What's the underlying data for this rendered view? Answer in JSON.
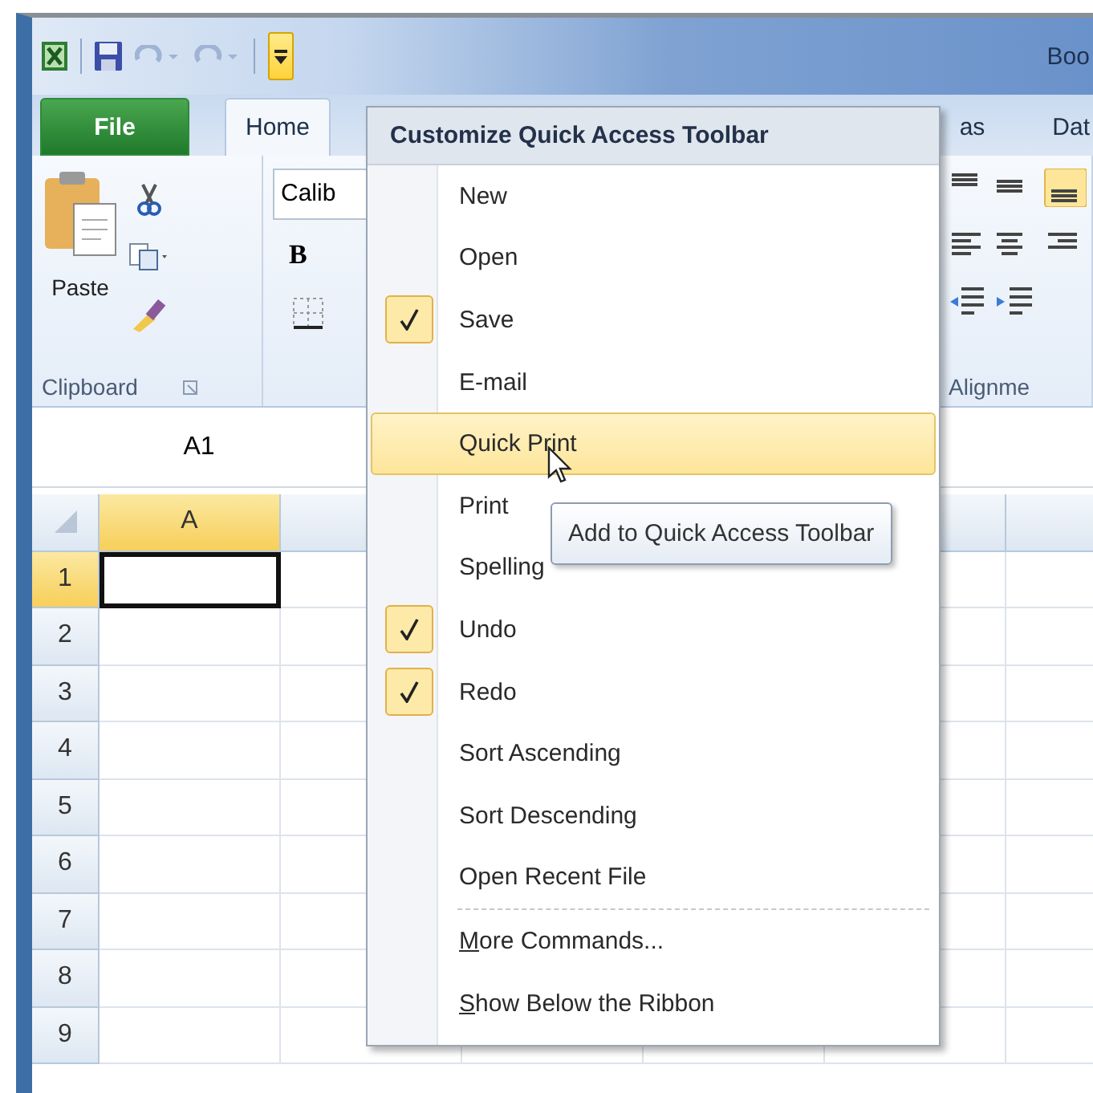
{
  "title_bar": {
    "title": "Boo",
    "customize_open": true
  },
  "tabs": [
    {
      "label": "File",
      "kind": "file",
      "selected": false
    },
    {
      "label": "Home",
      "kind": "tab",
      "selected": true
    },
    {
      "label": "as",
      "kind": "tab",
      "selected": false
    },
    {
      "label": "Dat",
      "kind": "tab",
      "selected": false
    }
  ],
  "ribbon": {
    "clipboard": {
      "paste_label": "Paste",
      "group_label": "Clipboard"
    },
    "font": {
      "font_name": "Calib",
      "bold_label": "B"
    },
    "alignment": {
      "group_label": "Alignme"
    }
  },
  "name_box": "A1",
  "grid": {
    "columns": [
      {
        "label": "A",
        "selected": true
      }
    ],
    "rows": [
      {
        "label": "1",
        "selected": true
      },
      {
        "label": "2",
        "selected": false
      },
      {
        "label": "3",
        "selected": false
      },
      {
        "label": "4",
        "selected": false
      },
      {
        "label": "5",
        "selected": false
      },
      {
        "label": "6",
        "selected": false
      },
      {
        "label": "7",
        "selected": false
      },
      {
        "label": "8",
        "selected": false
      },
      {
        "label": "9",
        "selected": false
      }
    ]
  },
  "menu": {
    "title": "Customize Quick Access Toolbar",
    "items": [
      {
        "label": "New",
        "checked": false,
        "highlighted": false,
        "separator_before": false
      },
      {
        "label": "Open",
        "checked": false,
        "highlighted": false,
        "separator_before": false
      },
      {
        "label": "Save",
        "checked": true,
        "highlighted": false,
        "separator_before": false
      },
      {
        "label": "E-mail",
        "checked": false,
        "highlighted": false,
        "separator_before": false
      },
      {
        "label": "Quick Print",
        "checked": false,
        "highlighted": true,
        "separator_before": false
      },
      {
        "label": "Print",
        "checked": false,
        "highlighted": false,
        "separator_before": false
      },
      {
        "label": "Spelling",
        "checked": false,
        "highlighted": false,
        "separator_before": false
      },
      {
        "label": "Undo",
        "checked": true,
        "highlighted": false,
        "separator_before": false
      },
      {
        "label": "Redo",
        "checked": true,
        "highlighted": false,
        "separator_before": false
      },
      {
        "label": "Sort Ascending",
        "checked": false,
        "highlighted": false,
        "separator_before": false
      },
      {
        "label": "Sort Descending",
        "checked": false,
        "highlighted": false,
        "separator_before": false
      },
      {
        "label": "Open Recent File",
        "checked": false,
        "highlighted": false,
        "separator_before": false
      },
      {
        "label": "More Commands...",
        "checked": false,
        "highlighted": false,
        "separator_before": true,
        "underline_first": true
      },
      {
        "label": "Show Below the Ribbon",
        "checked": false,
        "highlighted": false,
        "separator_before": false,
        "underline_first": true
      }
    ]
  },
  "tooltip": {
    "text": "Add to Quick Access Toolbar"
  }
}
